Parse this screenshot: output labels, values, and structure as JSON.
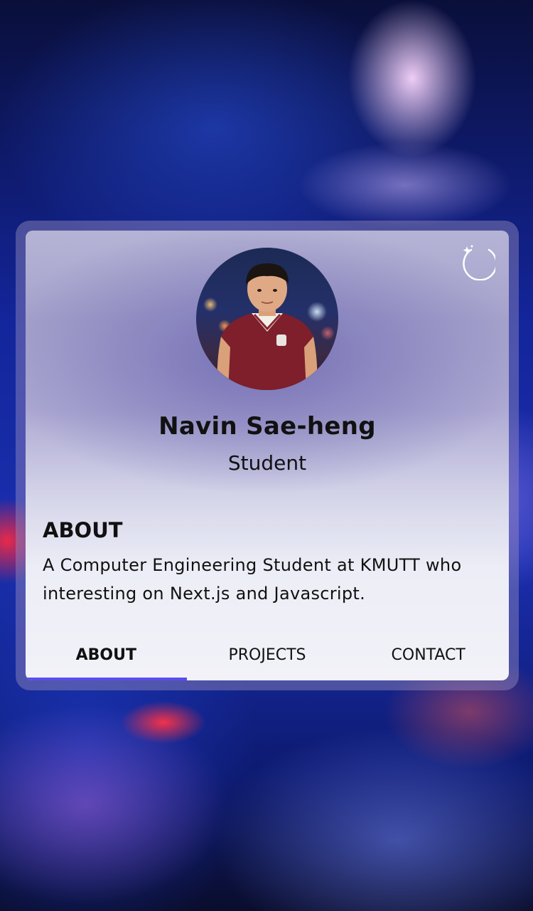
{
  "profile": {
    "name": "Navin Sae-heng",
    "role": "Student"
  },
  "about": {
    "heading": "ABOUT",
    "text": "A Computer Engineering Student at KMUTT who interesting on Next.js and Javascript."
  },
  "tabs": [
    {
      "label": "ABOUT",
      "active": true
    },
    {
      "label": "PROJECTS",
      "active": false
    },
    {
      "label": "CONTACT",
      "active": false
    }
  ],
  "icons": {
    "theme_toggle": "moon-sparkle-icon"
  },
  "colors": {
    "accent": "#5b4cf0"
  }
}
